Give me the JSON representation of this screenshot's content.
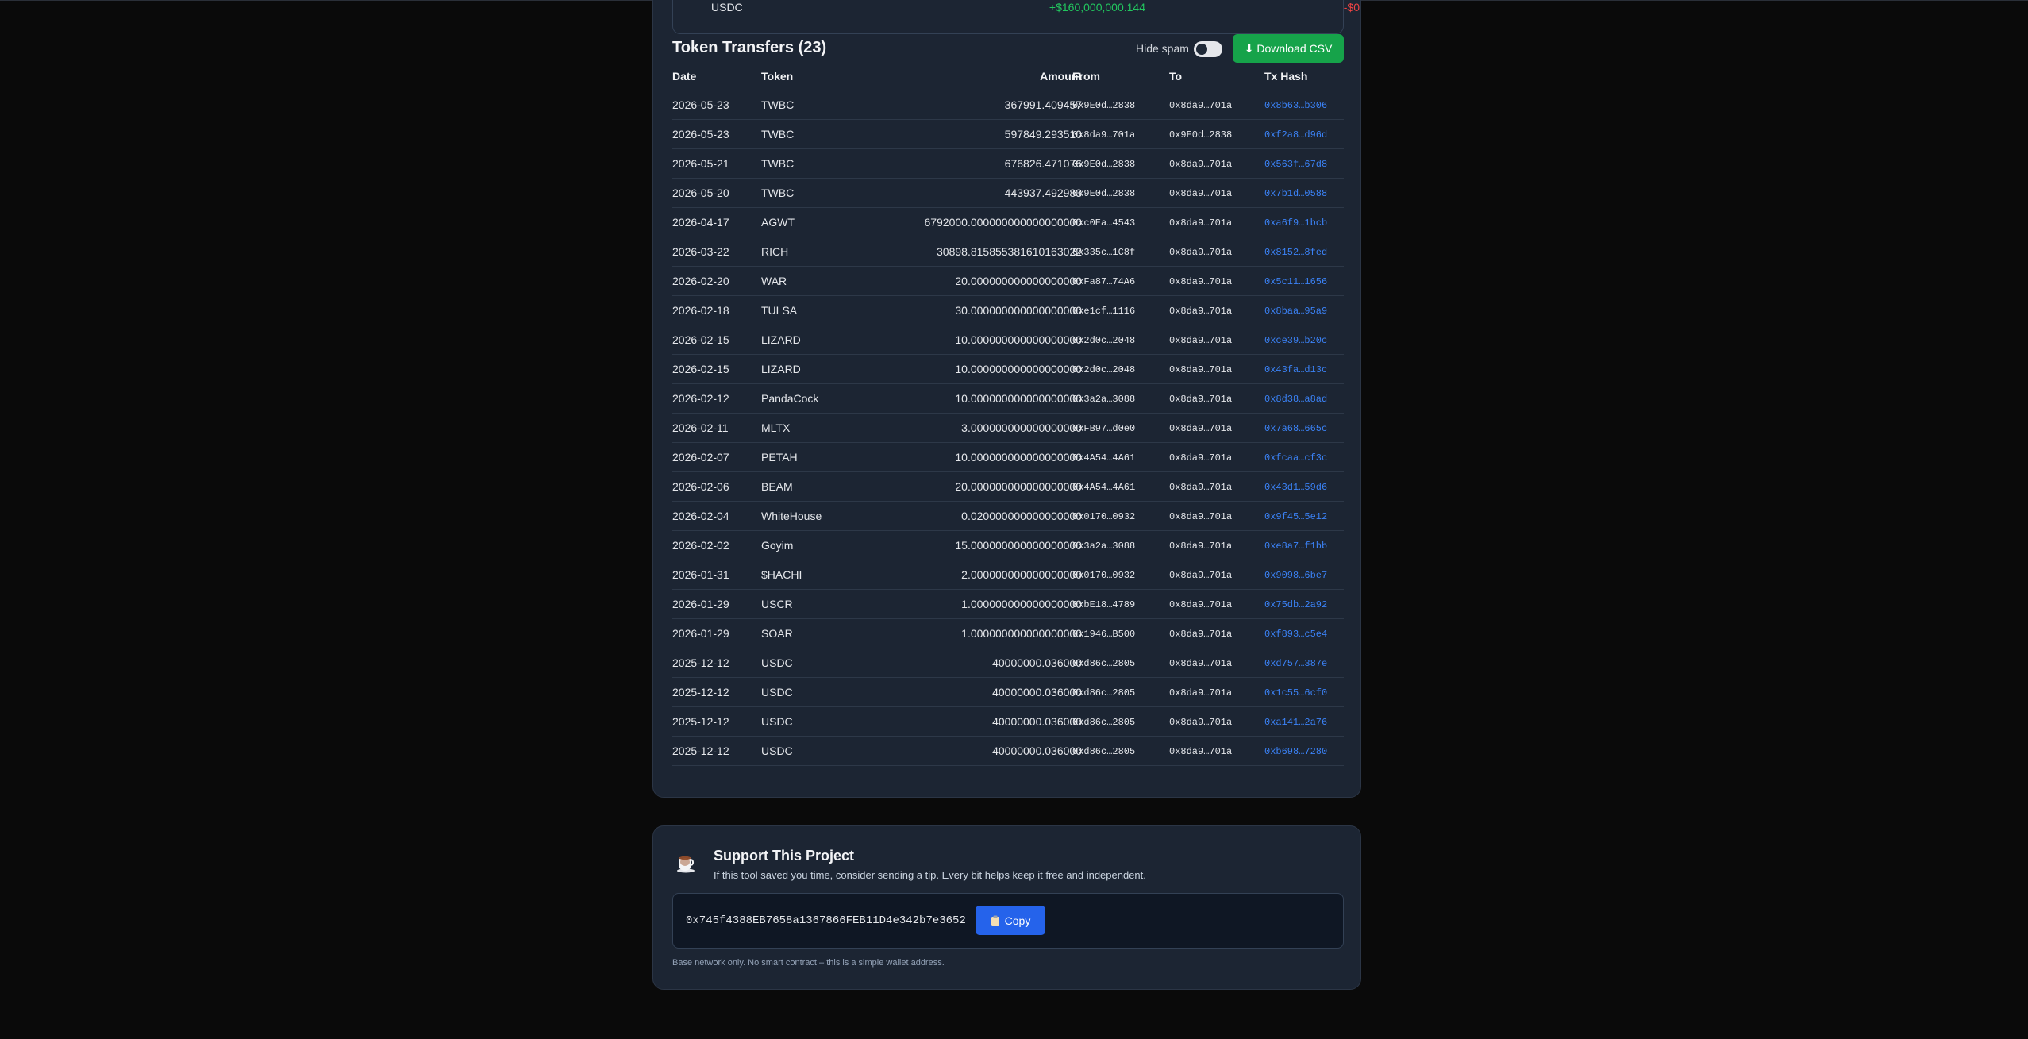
{
  "previous_row": {
    "symbol": "USDC",
    "in": "+$160,000,000.144",
    "out": "-$0"
  },
  "transfers": {
    "title": "Token Transfers (23)",
    "hide_spam_label": "Hide spam",
    "download_label": "⬇ Download CSV",
    "columns": {
      "date": "Date",
      "token": "Token",
      "amount": "Amount",
      "from": "From",
      "to": "To",
      "hash": "Tx Hash"
    },
    "rows": [
      {
        "date": "2026-05-23",
        "token": "TWBC",
        "amount": "367991.409457",
        "from": "0x9E0d…2838",
        "to": "0x8da9…701a",
        "hash": "0x8b63…b306"
      },
      {
        "date": "2026-05-23",
        "token": "TWBC",
        "amount": "597849.293510",
        "from": "0x8da9…701a",
        "to": "0x9E0d…2838",
        "hash": "0xf2a8…d96d"
      },
      {
        "date": "2026-05-21",
        "token": "TWBC",
        "amount": "676826.471076",
        "from": "0x9E0d…2838",
        "to": "0x8da9…701a",
        "hash": "0x563f…67d8"
      },
      {
        "date": "2026-05-20",
        "token": "TWBC",
        "amount": "443937.492983",
        "from": "0x9E0d…2838",
        "to": "0x8da9…701a",
        "hash": "0x7b1d…0588"
      },
      {
        "date": "2026-04-17",
        "token": "AGWT",
        "amount": "6792000.000000000000000000",
        "from": "0xc0Ea…4543",
        "to": "0x8da9…701a",
        "hash": "0xa6f9…1bcb"
      },
      {
        "date": "2026-03-22",
        "token": "RICH",
        "amount": "30898.815855381610163022",
        "from": "0x335c…1C8f",
        "to": "0x8da9…701a",
        "hash": "0x8152…8fed"
      },
      {
        "date": "2026-02-20",
        "token": "WAR",
        "amount": "20.000000000000000000",
        "from": "0xFa87…74A6",
        "to": "0x8da9…701a",
        "hash": "0x5c11…1656"
      },
      {
        "date": "2026-02-18",
        "token": "TULSA",
        "amount": "30.000000000000000000",
        "from": "0xe1cf…1116",
        "to": "0x8da9…701a",
        "hash": "0x8baa…95a9"
      },
      {
        "date": "2026-02-15",
        "token": "LIZARD",
        "amount": "10.000000000000000000",
        "from": "0x2d0c…2048",
        "to": "0x8da9…701a",
        "hash": "0xce39…b20c"
      },
      {
        "date": "2026-02-15",
        "token": "LIZARD",
        "amount": "10.000000000000000000",
        "from": "0x2d0c…2048",
        "to": "0x8da9…701a",
        "hash": "0x43fa…d13c"
      },
      {
        "date": "2026-02-12",
        "token": "PandaCock",
        "amount": "10.000000000000000000",
        "from": "0x3a2a…3088",
        "to": "0x8da9…701a",
        "hash": "0x8d38…a8ad"
      },
      {
        "date": "2026-02-11",
        "token": "MLTX",
        "amount": "3.000000000000000000",
        "from": "0xFB97…d0e0",
        "to": "0x8da9…701a",
        "hash": "0x7a68…665c"
      },
      {
        "date": "2026-02-07",
        "token": "PETAH",
        "amount": "10.000000000000000000",
        "from": "0x4A54…4A61",
        "to": "0x8da9…701a",
        "hash": "0xfcaa…cf3c"
      },
      {
        "date": "2026-02-06",
        "token": "BEAM",
        "amount": "20.000000000000000000",
        "from": "0x4A54…4A61",
        "to": "0x8da9…701a",
        "hash": "0x43d1…59d6"
      },
      {
        "date": "2026-02-04",
        "token": "WhiteHouse",
        "amount": "0.020000000000000000",
        "from": "0x0170…0932",
        "to": "0x8da9…701a",
        "hash": "0x9f45…5e12"
      },
      {
        "date": "2026-02-02",
        "token": "Goyim",
        "amount": "15.000000000000000000",
        "from": "0x3a2a…3088",
        "to": "0x8da9…701a",
        "hash": "0xe8a7…f1bb"
      },
      {
        "date": "2026-01-31",
        "token": "$HACHI",
        "amount": "2.000000000000000000",
        "from": "0x0170…0932",
        "to": "0x8da9…701a",
        "hash": "0x9098…6be7"
      },
      {
        "date": "2026-01-29",
        "token": "USCR",
        "amount": "1.000000000000000000",
        "from": "0xbE18…4789",
        "to": "0x8da9…701a",
        "hash": "0x75db…2a92"
      },
      {
        "date": "2026-01-29",
        "token": "SOAR",
        "amount": "1.000000000000000000",
        "from": "0x1946…B500",
        "to": "0x8da9…701a",
        "hash": "0xf893…c5e4"
      },
      {
        "date": "2025-12-12",
        "token": "USDC",
        "amount": "40000000.036000",
        "from": "0xd86c…2805",
        "to": "0x8da9…701a",
        "hash": "0xd757…387e"
      },
      {
        "date": "2025-12-12",
        "token": "USDC",
        "amount": "40000000.036000",
        "from": "0xd86c…2805",
        "to": "0x8da9…701a",
        "hash": "0x1c55…6cf0"
      },
      {
        "date": "2025-12-12",
        "token": "USDC",
        "amount": "40000000.036000",
        "from": "0xd86c…2805",
        "to": "0x8da9…701a",
        "hash": "0xa141…2a76"
      },
      {
        "date": "2025-12-12",
        "token": "USDC",
        "amount": "40000000.036000",
        "from": "0xd86c…2805",
        "to": "0x8da9…701a",
        "hash": "0xb698…7280"
      }
    ]
  },
  "support": {
    "title": "Support This Project",
    "text": "If this tool saved you time, consider sending a tip. Every bit helps keep it free and independent.",
    "address": "0x745f4388EB7658a1367866FEB11D4e342b7e3652",
    "copy_label": "Copy",
    "note": "Base network only. No smart contract – this is a simple wallet address."
  },
  "icons": {
    "coffee": "coffee-icon",
    "clipboard": "clipboard-icon"
  },
  "colors": {
    "accent_green": "#16a34a",
    "accent_blue": "#2563eb",
    "hash_link": "#3b82f6",
    "negative": "#ef4444",
    "positive": "#22c55e"
  }
}
